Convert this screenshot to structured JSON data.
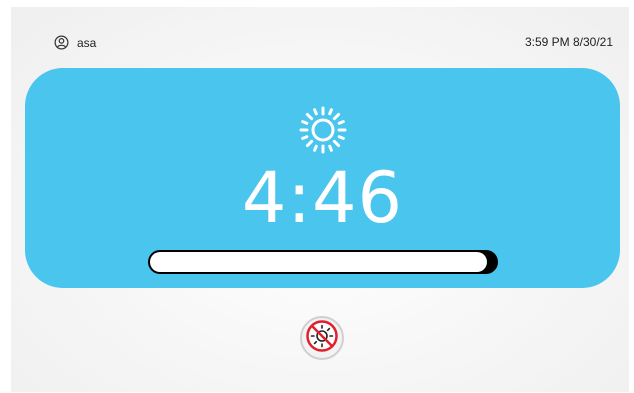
{
  "user": {
    "name": "asa",
    "icon": "user-circle-icon"
  },
  "status": {
    "datetime": "3:59 PM 8/30/21"
  },
  "timer": {
    "icon": "sun-icon",
    "time": "4:46",
    "progress": 0.99,
    "card_color": "#49c5ee"
  },
  "controls": {
    "no_sun_button_icon": "no-sun-icon",
    "prohibit_color": "#e0202a"
  }
}
